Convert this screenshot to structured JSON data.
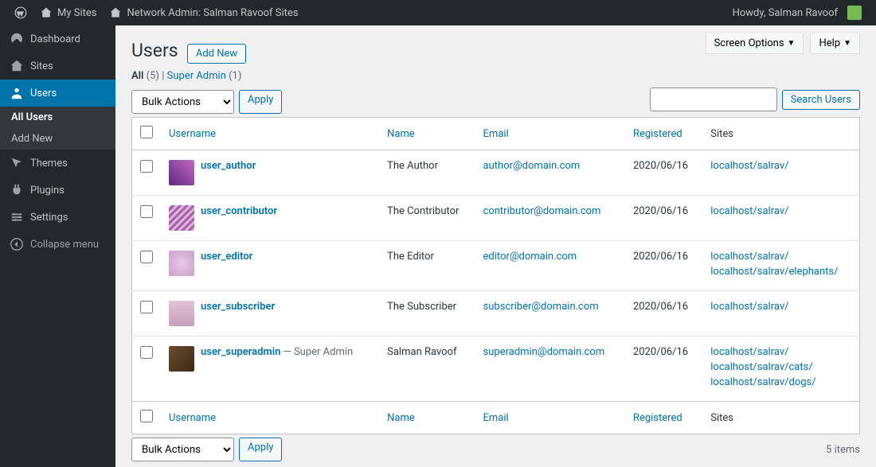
{
  "adminbar": {
    "my_sites": "My Sites",
    "site_name": "Network Admin: Salman Ravoof Sites",
    "howdy": "Howdy, Salman Ravoof"
  },
  "sidebar": {
    "items": [
      {
        "label": "Dashboard"
      },
      {
        "label": "Sites"
      },
      {
        "label": "Users"
      },
      {
        "label": "Themes"
      },
      {
        "label": "Plugins"
      },
      {
        "label": "Settings"
      }
    ],
    "sub": {
      "all_users": "All Users",
      "add_new": "Add New"
    },
    "collapse": "Collapse menu"
  },
  "top_panels": {
    "screen_options": "Screen Options",
    "help": "Help"
  },
  "page": {
    "title": "Users",
    "add_new": "Add New",
    "filters": {
      "all_label": "All",
      "all_count": "(5)",
      "sep": " | ",
      "super_label": "Super Admin",
      "super_count": "(1)"
    },
    "search_btn": "Search Users",
    "bulk_option": "Bulk Actions",
    "apply": "Apply",
    "items_count": "5 items"
  },
  "columns": {
    "username": "Username",
    "name": "Name",
    "email": "Email",
    "registered": "Registered",
    "sites": "Sites"
  },
  "rows": [
    {
      "username": "user_author",
      "badge": "",
      "name": "The Author",
      "email": "author@domain.com",
      "registered": "2020/06/16",
      "sites": [
        "localhost/salrav/"
      ],
      "avatar": "linear-gradient(45deg,#5a2a82,#c667c0)"
    },
    {
      "username": "user_contributor",
      "badge": "",
      "name": "The Contributor",
      "email": "contributor@domain.com",
      "registered": "2020/06/16",
      "sites": [
        "localhost/salrav/"
      ],
      "avatar": "repeating-linear-gradient(135deg,#d9b3d9 0 3px,#a85aa8 3px 6px)"
    },
    {
      "username": "user_editor",
      "badge": "",
      "name": "The Editor",
      "email": "editor@domain.com",
      "registered": "2020/06/16",
      "sites": [
        "localhost/salrav/",
        "localhost/salrav/elephants/"
      ],
      "avatar": "radial-gradient(#e8c9e8,#caa0ca)"
    },
    {
      "username": "user_subscriber",
      "badge": "",
      "name": "The Subscriber",
      "email": "subscriber@domain.com",
      "registered": "2020/06/16",
      "sites": [
        "localhost/salrav/"
      ],
      "avatar": "linear-gradient(#e3c2d6,#c79fb9)"
    },
    {
      "username": "user_superadmin",
      "badge": " — Super Admin",
      "name": "Salman Ravoof",
      "email": "superadmin@domain.com",
      "registered": "2020/06/16",
      "sites": [
        "localhost/salrav/",
        "localhost/salrav/cats/",
        "localhost/salrav/dogs/"
      ],
      "avatar": "linear-gradient(135deg,#6b4b2a,#3a2a1a)"
    }
  ]
}
